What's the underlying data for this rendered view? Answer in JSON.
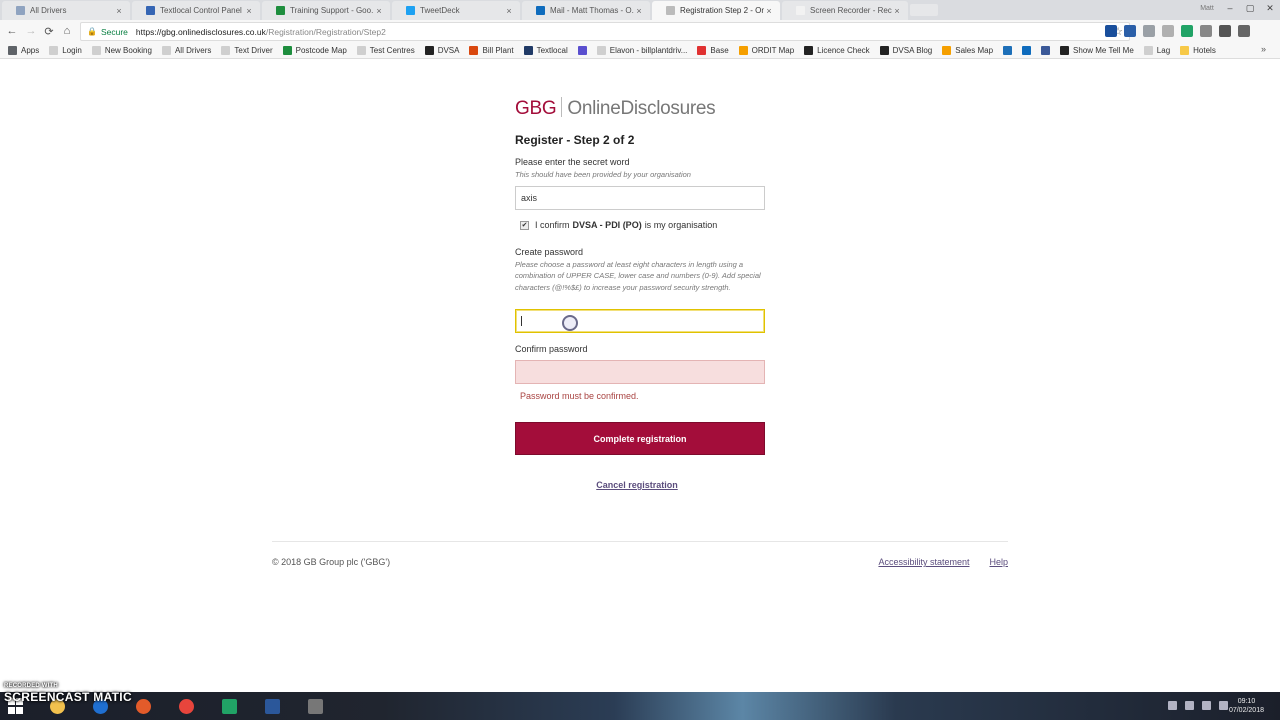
{
  "browser": {
    "tabs": [
      {
        "title": "All Drivers",
        "favicon_color": "#8fa3c0",
        "active": false
      },
      {
        "title": "Textlocal Control Panel",
        "favicon_color": "#3565b4",
        "active": false
      },
      {
        "title": "Training Support - Goo...",
        "favicon_color": "#1e8e3e",
        "active": false
      },
      {
        "title": "TweetDeck",
        "favicon_color": "#1da1f2",
        "active": false
      },
      {
        "title": "Mail - Matt Thomas - O...",
        "favicon_color": "#0f6cbd",
        "active": false
      },
      {
        "title": "Registration Step 2 - On...",
        "favicon_color": "#bbbbbb",
        "active": true
      },
      {
        "title": "Screen Recorder - Recor...",
        "favicon_color": "#f2f2f2",
        "active": false
      }
    ],
    "tab_close": "×",
    "user_label": "Matt",
    "window_controls": {
      "minimize": "–",
      "maximize": "▢",
      "close": "✕"
    },
    "nav": {
      "back": "←",
      "forward": "→",
      "reload": "⟳",
      "home": "⌂"
    },
    "address": {
      "secure_label": "Secure",
      "lock_icon": "🔒",
      "host": "https://gbg.onlinedisclosures.co.uk",
      "path": "/Registration/Registration/Step2"
    },
    "star_icon": "☆",
    "extension_colors": [
      "#1a4f9c",
      "#2b5fa8",
      "#9aa0a6",
      "#b0b0b0",
      "#21a366",
      "#888",
      "#555",
      "#666"
    ],
    "bookmarks": [
      {
        "label": "Apps",
        "icon_color": "#5f6368"
      },
      {
        "label": "Login",
        "icon_color": "#cfcfcf"
      },
      {
        "label": "New Booking",
        "icon_color": "#cfcfcf"
      },
      {
        "label": "All Drivers",
        "icon_color": "#cfcfcf"
      },
      {
        "label": "Text Driver",
        "icon_color": "#cfcfcf"
      },
      {
        "label": "Postcode Map",
        "icon_color": "#1e8e3e"
      },
      {
        "label": "Test Centres",
        "icon_color": "#cfcfcf"
      },
      {
        "label": "DVSA",
        "icon_color": "#222222"
      },
      {
        "label": "Bill Plant",
        "icon_color": "#d9480f"
      },
      {
        "label": "Textlocal",
        "icon_color": "#203a66"
      },
      {
        "label": "",
        "icon_color": "#5a4fcf"
      },
      {
        "label": "Elavon - billplantdriv...",
        "icon_color": "#cfcfcf"
      },
      {
        "label": "Base",
        "icon_color": "#e03131"
      },
      {
        "label": "ORDIT Map",
        "icon_color": "#f59f00"
      },
      {
        "label": "Licence Check",
        "icon_color": "#222222"
      },
      {
        "label": "DVSA Blog",
        "icon_color": "#222222"
      },
      {
        "label": "Sales Map",
        "icon_color": "#f59f00"
      },
      {
        "label": "",
        "icon_color": "#1d6fb8"
      },
      {
        "label": "",
        "icon_color": "#0f6cbd"
      },
      {
        "label": "",
        "icon_color": "#3b5998"
      },
      {
        "label": "Show Me Tell Me",
        "icon_color": "#222222"
      },
      {
        "label": "Lag",
        "icon_color": "#cfcfcf"
      },
      {
        "label": "Hotels",
        "icon_color": "#f7c948"
      }
    ],
    "bookmarks_more": "»"
  },
  "page": {
    "logo": {
      "brand": "GBG",
      "product": "OnlineDisclosures"
    },
    "heading": "Register - Step 2 of 2",
    "secret_word": {
      "label": "Please enter the secret word",
      "hint": "This should have been provided by your organisation",
      "value": "axis"
    },
    "confirm_org": {
      "checked_mark": "✔",
      "prefix": "I confirm",
      "org": "DVSA - PDI (PO)",
      "suffix": "is my organisation"
    },
    "password": {
      "label": "Create password",
      "hint": "Please choose a password at least eight characters in length using a combination of UPPER CASE, lower case and numbers (0-9). Add special characters (@!%$£) to increase your password security strength.",
      "value": ""
    },
    "confirm_password": {
      "label": "Confirm password",
      "value": "",
      "error": "Password must be confirmed."
    },
    "submit_label": "Complete registration",
    "cancel_label": "Cancel registration"
  },
  "footer": {
    "copyright": "© 2018 GB Group plc ('GBG')",
    "links": [
      "Accessibility statement",
      "Help"
    ]
  },
  "taskbar": {
    "watermark_top": "RECORDED WITH",
    "watermark_brand": "SCREENCAST  MATIC",
    "time": "09:10",
    "date": "07/02/2018",
    "apps": [
      {
        "name": "file-explorer",
        "color": "#f2c14e"
      },
      {
        "name": "outlook",
        "color": "#1f6fd1"
      },
      {
        "name": "screencast",
        "color": "#e35b2a"
      },
      {
        "name": "chrome",
        "color": "#e8453c"
      },
      {
        "name": "excel",
        "color": "#21a366"
      },
      {
        "name": "word",
        "color": "#2b579a"
      },
      {
        "name": "tool",
        "color": "#777777"
      }
    ]
  }
}
